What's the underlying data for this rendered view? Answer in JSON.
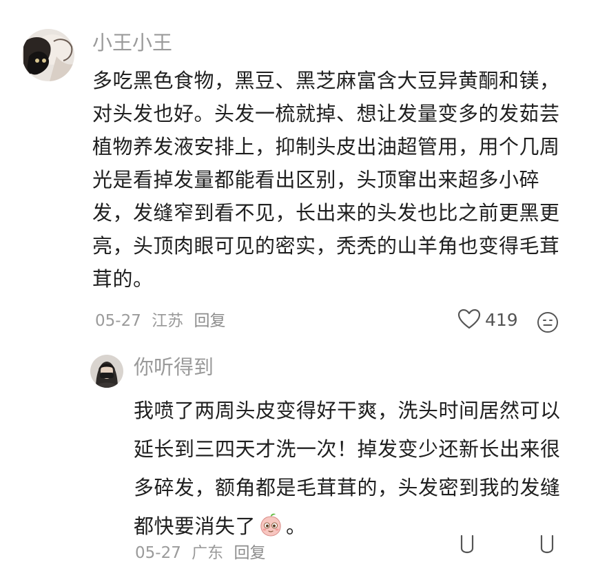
{
  "comment": {
    "username": "小王小王",
    "text": "多吃黑色食物，黑豆、黑芝麻富含大豆异黄酮和镁，对头发也好。头发一梳就掉、想让发量变多的发茹芸植物养发液安排上，抑制头皮出油超管用，用个几周光是看掉发量都能看出区别，头顶窜出来超多小碎发，发缝窄到看不见，长出来的头发也比之前更黑更亮，头顶肉眼可见的密实，秃秃的山羊角也变得毛茸茸的。",
    "date": "05-27",
    "location": "江苏",
    "reply_label": "回复",
    "like_count": "419",
    "icons": [
      "heart-outline-icon",
      "emoji-icon"
    ]
  },
  "reply": {
    "username": "你听得到",
    "text_before_emoji": "我喷了两周头皮变得好干爽，洗头时间居然可以延长到三四天才洗一次！掉发变少还新长出来很多碎发，额角都是毛茸茸的，头发密到我的发缝都快要消失了",
    "emoji_name": "peach-cheeky-emoji",
    "text_after_emoji": "。",
    "date": "05-27",
    "location": "广东",
    "reply_label": "回复",
    "icons": [
      "dislike-icon",
      "like-icon"
    ]
  }
}
